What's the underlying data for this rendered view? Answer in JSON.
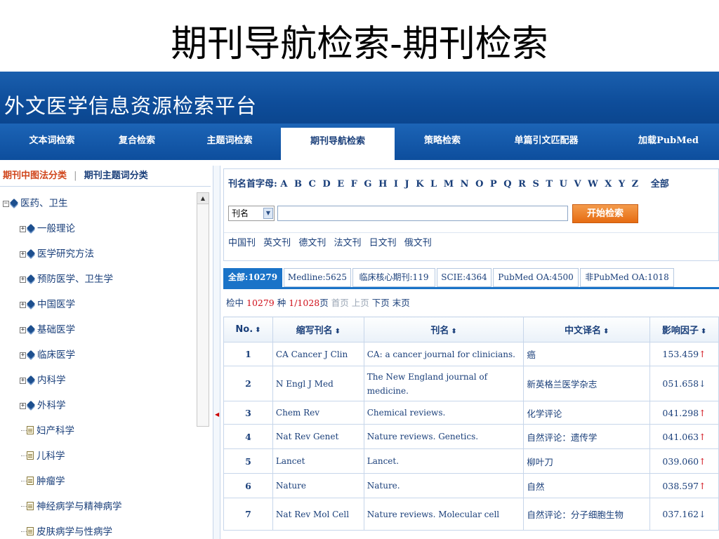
{
  "slide": {
    "title": "期刊导航检索-期刊检索"
  },
  "app": {
    "title": "外文医学信息资源检索平台"
  },
  "nav": {
    "items": [
      {
        "label": "文本词检索"
      },
      {
        "label": "复合检索"
      },
      {
        "label": "主题词检索"
      },
      {
        "label": "期刊导航检索",
        "active": true
      },
      {
        "label": "策略检索"
      },
      {
        "label": "单篇引文匹配器"
      },
      {
        "label": "加载PubMed"
      }
    ]
  },
  "sidebar": {
    "tab_active": "期刊中图法分类",
    "separator": "|",
    "tab_other": "期刊主题词分类",
    "tree": [
      {
        "label": "医药、卫生",
        "toggle": "−",
        "level": 0,
        "icon": "book"
      },
      {
        "label": "一般理论",
        "toggle": "+",
        "level": 1,
        "icon": "book"
      },
      {
        "label": "医学研究方法",
        "toggle": "+",
        "level": 1,
        "icon": "book"
      },
      {
        "label": "预防医学、卫生学",
        "toggle": "+",
        "level": 1,
        "icon": "book"
      },
      {
        "label": "中国医学",
        "toggle": "+",
        "level": 1,
        "icon": "book"
      },
      {
        "label": "基础医学",
        "toggle": "+",
        "level": 1,
        "icon": "book"
      },
      {
        "label": "临床医学",
        "toggle": "+",
        "level": 1,
        "icon": "book"
      },
      {
        "label": "内科学",
        "toggle": "+",
        "level": 1,
        "icon": "book"
      },
      {
        "label": "外科学",
        "toggle": "+",
        "level": 1,
        "icon": "book"
      },
      {
        "label": "妇产科学",
        "level": 1,
        "icon": "doc"
      },
      {
        "label": "儿科学",
        "level": 1,
        "icon": "doc"
      },
      {
        "label": "肿瘤学",
        "level": 1,
        "icon": "doc"
      },
      {
        "label": "神经病学与精神病学",
        "level": 1,
        "icon": "doc"
      },
      {
        "label": "皮肤病学与性病学",
        "level": 1,
        "icon": "doc"
      }
    ]
  },
  "letters": {
    "label": "刊名首字母:",
    "items": [
      "A",
      "B",
      "C",
      "D",
      "E",
      "F",
      "G",
      "H",
      "I",
      "J",
      "K",
      "L",
      "M",
      "N",
      "O",
      "P",
      "Q",
      "R",
      "S",
      "T",
      "U",
      "V",
      "W",
      "X",
      "Y",
      "Z"
    ],
    "all": "全部"
  },
  "search": {
    "select_value": "刊名",
    "input_value": "",
    "button": "开始检索"
  },
  "languages": [
    "中国刊",
    "英文刊",
    "德文刊",
    "法文刊",
    "日文刊",
    "俄文刊"
  ],
  "filter_tabs": [
    {
      "label": "全部:10279",
      "active": true
    },
    {
      "label": "Medline:5625"
    },
    {
      "label": "临床核心期刊:119"
    },
    {
      "label": "SCIE:4364"
    },
    {
      "label": "PubMed OA:4500"
    },
    {
      "label": "非PubMed OA:1018"
    }
  ],
  "result": {
    "prefix": "检中",
    "count": "10279",
    "unit": "种",
    "page": "1/1028",
    "page_unit": "页",
    "first": "首页",
    "prev": "上页",
    "next": "下页",
    "last": "末页"
  },
  "table": {
    "headers": [
      "No.",
      "缩写刊名",
      "刊名",
      "中文译名",
      "影响因子"
    ],
    "sort_icon": "⬍",
    "rows": [
      {
        "no": "1",
        "abbr": "CA Cancer J Clin",
        "title": "CA: a cancer journal for clinicians.",
        "cn": "癌",
        "if": "153.459",
        "trend": "↑"
      },
      {
        "no": "2",
        "abbr": "N Engl J Med",
        "title": "The New England journal of medicine.",
        "cn": "新英格兰医学杂志",
        "if": "051.658",
        "trend": "↓"
      },
      {
        "no": "3",
        "abbr": "Chem Rev",
        "title": "Chemical reviews.",
        "cn": "化学评论",
        "if": "041.298",
        "trend": "↑"
      },
      {
        "no": "4",
        "abbr": "Nat Rev Genet",
        "title": "Nature reviews. Genetics.",
        "cn": "自然评论：遗传学",
        "if": "041.063",
        "trend": "↑"
      },
      {
        "no": "5",
        "abbr": "Lancet",
        "title": "Lancet.",
        "cn": "柳叶刀",
        "if": "039.060",
        "trend": "↑"
      },
      {
        "no": "6",
        "abbr": "Nature",
        "title": "Nature.",
        "cn": "自然",
        "if": "038.597",
        "trend": "↑"
      },
      {
        "no": "7",
        "abbr": "Nat Rev Mol Cell",
        "title": "Nature reviews. Molecular cell",
        "cn": "自然评论：分子细胞生物",
        "if": "037.162",
        "trend": "↓"
      }
    ]
  },
  "colors": {
    "banner": "#0e4d9a",
    "accent": "#1a73c8",
    "button": "#e66c12",
    "link": "#1a3f7a",
    "highlight": "#d0451b"
  }
}
